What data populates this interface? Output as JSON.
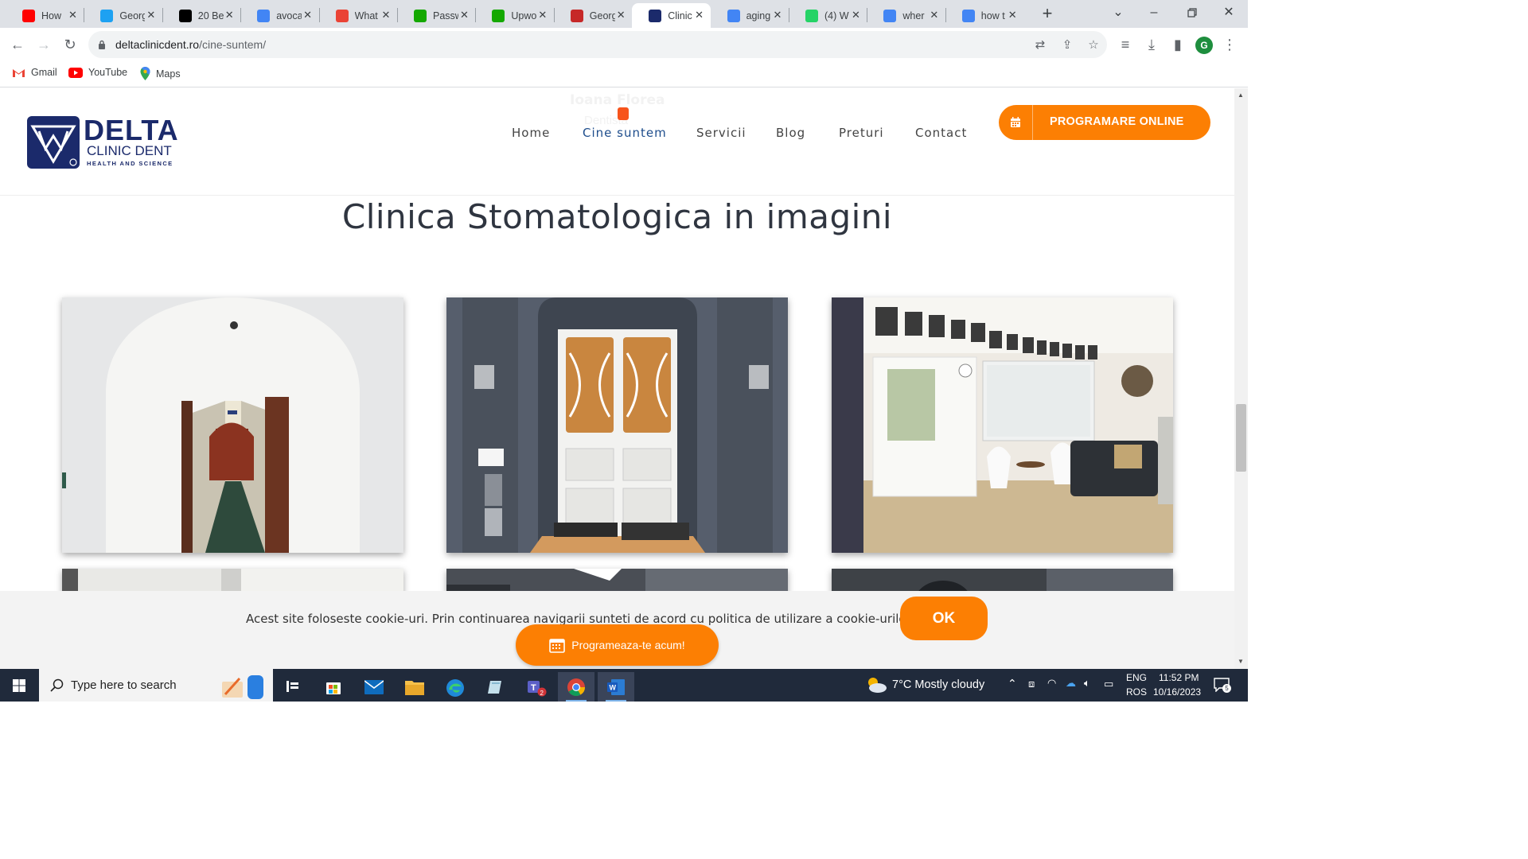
{
  "browser": {
    "tabs": [
      {
        "title": "How",
        "icon": "youtube-icon",
        "color": "#ff0000"
      },
      {
        "title": "Georg",
        "icon": "bird-icon",
        "color": "#1da1f2"
      },
      {
        "title": "20 Be",
        "icon": "wix-icon",
        "color": "#000000"
      },
      {
        "title": "avoca",
        "icon": "google-icon",
        "color": "#4285f4"
      },
      {
        "title": "What",
        "icon": "alert-icon",
        "color": "#ea4335"
      },
      {
        "title": "Passw",
        "icon": "upwork-icon",
        "color": "#14a800"
      },
      {
        "title": "Upwo",
        "icon": "upwork-icon",
        "color": "#14a800"
      },
      {
        "title": "Georg",
        "icon": "gc-icon",
        "color": "#c62828"
      },
      {
        "title": "Clinic",
        "icon": "delta-icon",
        "color": "#1b2a6b",
        "active": true
      },
      {
        "title": "aging",
        "icon": "google-icon",
        "color": "#4285f4"
      },
      {
        "title": "(4) W",
        "icon": "whatsapp-icon",
        "color": "#25d366"
      },
      {
        "title": "wher",
        "icon": "google-icon",
        "color": "#4285f4"
      },
      {
        "title": "how t",
        "icon": "google-icon",
        "color": "#4285f4"
      }
    ],
    "url_host": "deltaclinicdent.ro",
    "url_path": "/cine-suntem/",
    "avatar_letter": "G",
    "bookmarks": [
      {
        "label": "Gmail",
        "icon": "gmail-icon"
      },
      {
        "label": "YouTube",
        "icon": "youtube-icon"
      },
      {
        "label": "Maps",
        "icon": "maps-icon"
      }
    ]
  },
  "site": {
    "logo": {
      "line1": "DELTA",
      "line2": "CLINIC DENT",
      "line3": "HEALTH AND SCIENCE"
    },
    "ghost_name": "Ioana Florea",
    "ghost_sub": "Dentista",
    "nav": [
      {
        "label": "Home"
      },
      {
        "label": "Cine suntem",
        "current": true
      },
      {
        "label": "Servicii"
      },
      {
        "label": "Blog"
      },
      {
        "label": "Preturi"
      },
      {
        "label": "Contact"
      }
    ],
    "cta_label": "PROGRAMARE ONLINE",
    "accent_color": "#fc7f03",
    "brand_color": "#1b2a6b",
    "page_title": "Clinica Stomatologica in imagini",
    "gallery": [
      {
        "name": "gallery-photo-hallway"
      },
      {
        "name": "gallery-photo-entrance-door"
      },
      {
        "name": "gallery-photo-waiting-room"
      },
      {
        "name": "gallery-photo-row2-1"
      },
      {
        "name": "gallery-photo-row2-2"
      },
      {
        "name": "gallery-photo-row2-3"
      }
    ],
    "cookie_text": "Acest site foloseste cookie-uri. Prin continuarea navigarii sunteti de acord cu politica de utilizare a cookie-urilor.",
    "cookie_ok": "OK",
    "float_cta": "Programeaza-te acum!"
  },
  "taskbar": {
    "search_placeholder": "Type here to search",
    "weather": "7°C  Mostly cloudy",
    "lang_top": "ENG",
    "lang_bottom": "ROS",
    "time": "11:52 PM",
    "date": "10/16/2023",
    "notifications": "5"
  }
}
